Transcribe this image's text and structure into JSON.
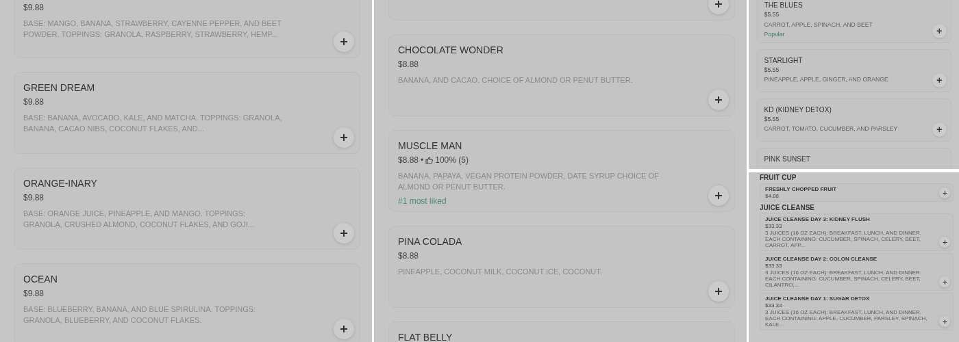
{
  "panels": [
    {
      "kind": "large",
      "sections": [
        {
          "items": [
            {
              "kind": "dish",
              "price": "$9.88",
              "description": "BASE: MANGO, BANANA, STRAWBERRY, CAYENNE PEPPER, AND BEET POWDER. TOPPINGS: GRANOLA, RASPBERRY, STRAWBERRY, HEMP..."
            },
            {
              "kind": "dish",
              "name": "GREEN DREAM",
              "price": "$9.88",
              "description": "BASE: BANANA, AVOCADO, KALE, AND MATCHA. TOPPINGS: GRANOLA, BANANA, CACAO NIBS, COCONUT FLAKES, AND..."
            },
            {
              "kind": "dish",
              "name": "ORANGE-INARY",
              "price": "$9.88",
              "description": "BASE: ORANGE JUICE, PINEAPPLE, AND MANGO. TOPPINGS: GRANOLA, CRUSHED ALMOND, COCONUT FLAKES, AND GOJI..."
            },
            {
              "kind": "dish",
              "name": "OCEAN",
              "price": "$9.88",
              "description": "BASE: BLUEBERRY, BANANA, AND BLUE SPIRULINA. TOPPINGS: GRANOLA, BLUEBERRY, AND COCONUT FLAKES."
            }
          ]
        }
      ]
    },
    {
      "kind": "large",
      "sections": [
        {
          "items": [
            {
              "kind": "dish"
            },
            {
              "kind": "dish",
              "name": "CHOCOLATE WONDER",
              "price": "$8.88",
              "description": "BANANA, AND CACAO. CHOICE OF ALMOND OR PENUT BUTTER."
            },
            {
              "kind": "dish",
              "name": "MUSCLE MAN",
              "price": "$8.88",
              "separator": "•",
              "rating": "100% (5)",
              "description": "BANANA, PAPAYA, VEGAN PROTEIN POWDER, DATE SYRUP CHOICE OF ALMOND OR PENUT BUTTER.",
              "badge": "#1 most liked"
            },
            {
              "kind": "dish",
              "name": "PINA COLADA",
              "price": "$8.88",
              "description": "PINEAPPLE, COCONUT MILK, COCONUT ICE, COCONUT."
            },
            {
              "kind": "dish",
              "name": "FLAT BELLY"
            }
          ]
        }
      ]
    },
    {
      "kind": "small",
      "sections": [
        {
          "items": [
            {
              "kind": "dish",
              "name": "THE BLUES",
              "price": "$5.55",
              "description": "CARROT, APPLE, SPINACH, AND BEET",
              "badge": "Popular"
            },
            {
              "kind": "dish",
              "name": "STARLIGHT",
              "price": "$5.55",
              "description": "PINEAPPLE, APPLE, GINGER, AND ORANGE"
            },
            {
              "kind": "dish",
              "name": "KD (KIDNEY DETOX)",
              "price": "$5.55",
              "description": "CARROT, TOMATO, CUCUMBER, AND PARSLEY"
            },
            {
              "kind": "dish",
              "name": "PINK SUNSET"
            }
          ]
        }
      ]
    },
    {
      "kind": "tiny",
      "sections": [
        {
          "heading": "FRUIT CUP",
          "items": [
            {
              "kind": "dish",
              "name": "FRESHLY CHOPPED FRUIT",
              "price": "$4.88"
            }
          ]
        },
        {
          "heading": "JUICE CLEANSE",
          "items": [
            {
              "kind": "dish",
              "name": "JUICE CLEANSE DAY 3: KIDNEY FLUSH",
              "price": "$33.33",
              "description": "3 JUICES (16 OZ EACH): BREAKFAST, LUNCH, AND DINNER. EACH CONTAINING: CUCUMBER, SPINACH, CELERY, BEET, CARROT, APP..."
            },
            {
              "kind": "dish",
              "name": "JUICE CLEANSE DAY 2: COLON CLEANSE",
              "price": "$33.33",
              "description": "3 JUICES (16 OZ EACH): BREAKFAST, LUNCH, AND DINNER. EACH CONTAINING: CUCUMBER, SPINACH, CELERY, BEET, CILANTRO,..."
            },
            {
              "kind": "dish",
              "name": "JUICE CLEANSE DAY 1: SUGAR DETOX",
              "price": "$33.33",
              "description": "3 JUICES (16 OZ EACH): BREAKFAST, LUNCH, AND DINNER. EACH CONTAINING: APPLE, CUCUMBER, PARSLEY, SPINACH, KALE..."
            }
          ]
        }
      ]
    }
  ]
}
